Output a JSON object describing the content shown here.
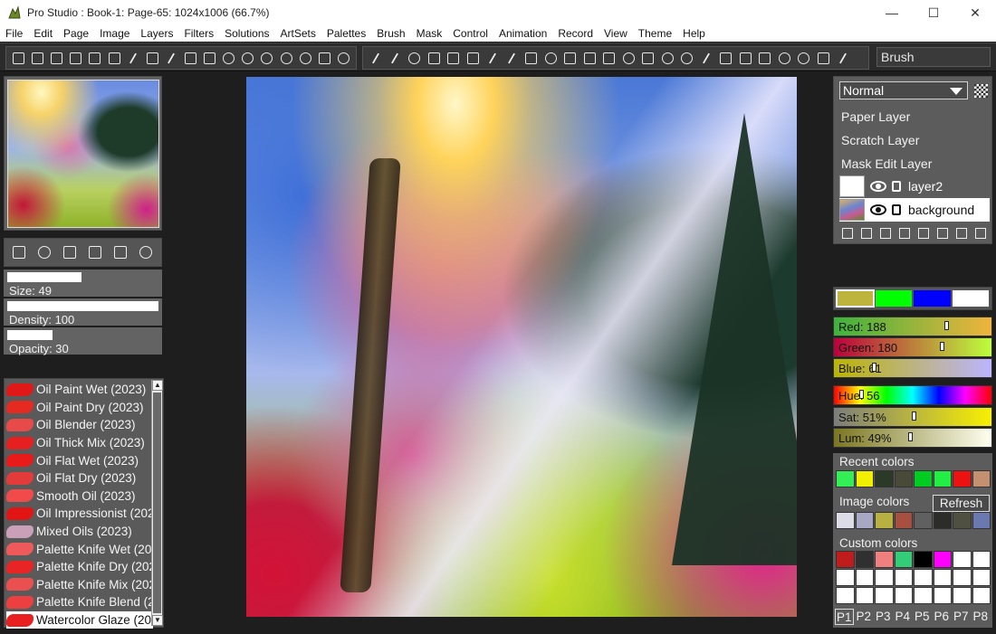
{
  "window": {
    "title": "Pro Studio : Book-1: Page-65: 1024x1006  (66.7%)",
    "minimize": "—",
    "maximize": "☐",
    "close": "✕"
  },
  "menu": [
    "File",
    "Edit",
    "Page",
    "Image",
    "Layers",
    "Filters",
    "Solutions",
    "ArtSets",
    "Palettes",
    "Brush",
    "Mask",
    "Control",
    "Animation",
    "Record",
    "View",
    "Theme",
    "Help"
  ],
  "toolbar": {
    "brush_field": "Brush"
  },
  "brush_settings": {
    "size_label": "Size: 49",
    "size_level": 0.49,
    "density_label": "Density: 100",
    "density_level": 1.0,
    "opacity_label": "Opacity: 30",
    "opacity_level": 0.3
  },
  "brushes": [
    {
      "name": "Oil Paint Wet (2023)",
      "color": "#e01818"
    },
    {
      "name": "Oil Paint Dry (2023)",
      "color": "#e52a22"
    },
    {
      "name": "Oil Blender (2023)",
      "color": "#e84a4a"
    },
    {
      "name": "Oil Thick Mix (2023)",
      "color": "#e62020"
    },
    {
      "name": "Oil Flat Wet (2023)",
      "color": "#e81a1a"
    },
    {
      "name": "Oil Flat Dry (2023)",
      "color": "#e33a3a"
    },
    {
      "name": "Smooth Oil (2023)",
      "color": "#f04a4a"
    },
    {
      "name": "Oil Impressionist (2023)",
      "color": "#e21515"
    },
    {
      "name": "Mixed Oils (2023)",
      "color": "#c9a0b8"
    },
    {
      "name": "Palette Knife Wet (2023)",
      "color": "#ee5a5a"
    },
    {
      "name": "Palette Knife Dry (2023)",
      "color": "#e82424"
    },
    {
      "name": "Palette Knife Mix (2023)",
      "color": "#ea5050"
    },
    {
      "name": "Palette Knife Blend (2023)",
      "color": "#ec4040"
    },
    {
      "name": "Watercolor Glaze (2023)",
      "color": "#e82020",
      "selected": true
    }
  ],
  "layers": {
    "blend_mode": "Normal",
    "special": [
      "Paper Layer",
      "Scratch Layer",
      "Mask Edit Layer"
    ],
    "items": [
      {
        "name": "layer2",
        "active": false
      },
      {
        "name": "background",
        "active": true
      }
    ]
  },
  "main_swatches": [
    "#bcb43c",
    "#00ff00",
    "#0000ff",
    "#ffffff"
  ],
  "color_sliders": {
    "red": {
      "label": "Red: 188",
      "value": 188
    },
    "green": {
      "label": "Green: 180",
      "value": 180
    },
    "blue": {
      "label": "Blue: 61",
      "value": 61
    },
    "hue": {
      "label": "Hue: 56",
      "value": 56
    },
    "sat": {
      "label": "Sat: 51%",
      "value": 51
    },
    "lum": {
      "label": "Lum: 49%",
      "value": 49
    }
  },
  "recent_colors": {
    "title": "Recent colors",
    "colors": [
      "#33ee55",
      "#f0f000",
      "#2a3a26",
      "#4a4a38",
      "#00cc22",
      "#22ee44",
      "#ee1111",
      "#c49070"
    ]
  },
  "image_colors": {
    "title": "Image colors",
    "refresh": "Refresh",
    "colors": [
      "#dcdce6",
      "#a8a8c4",
      "#b8b040",
      "#a85040",
      "#606060",
      "#2c2c28",
      "#505040",
      "#6a7ab0"
    ]
  },
  "custom_colors": {
    "title": "Custom colors",
    "colors": [
      "#c01c1c",
      "#303030",
      "#f08080",
      "#33cc77",
      "#000000",
      "#ff00ff",
      "#ffffff",
      "#ffffff"
    ],
    "tabs": [
      "P1",
      "P2",
      "P3",
      "P4",
      "P5",
      "P6",
      "P7",
      "P8"
    ]
  }
}
